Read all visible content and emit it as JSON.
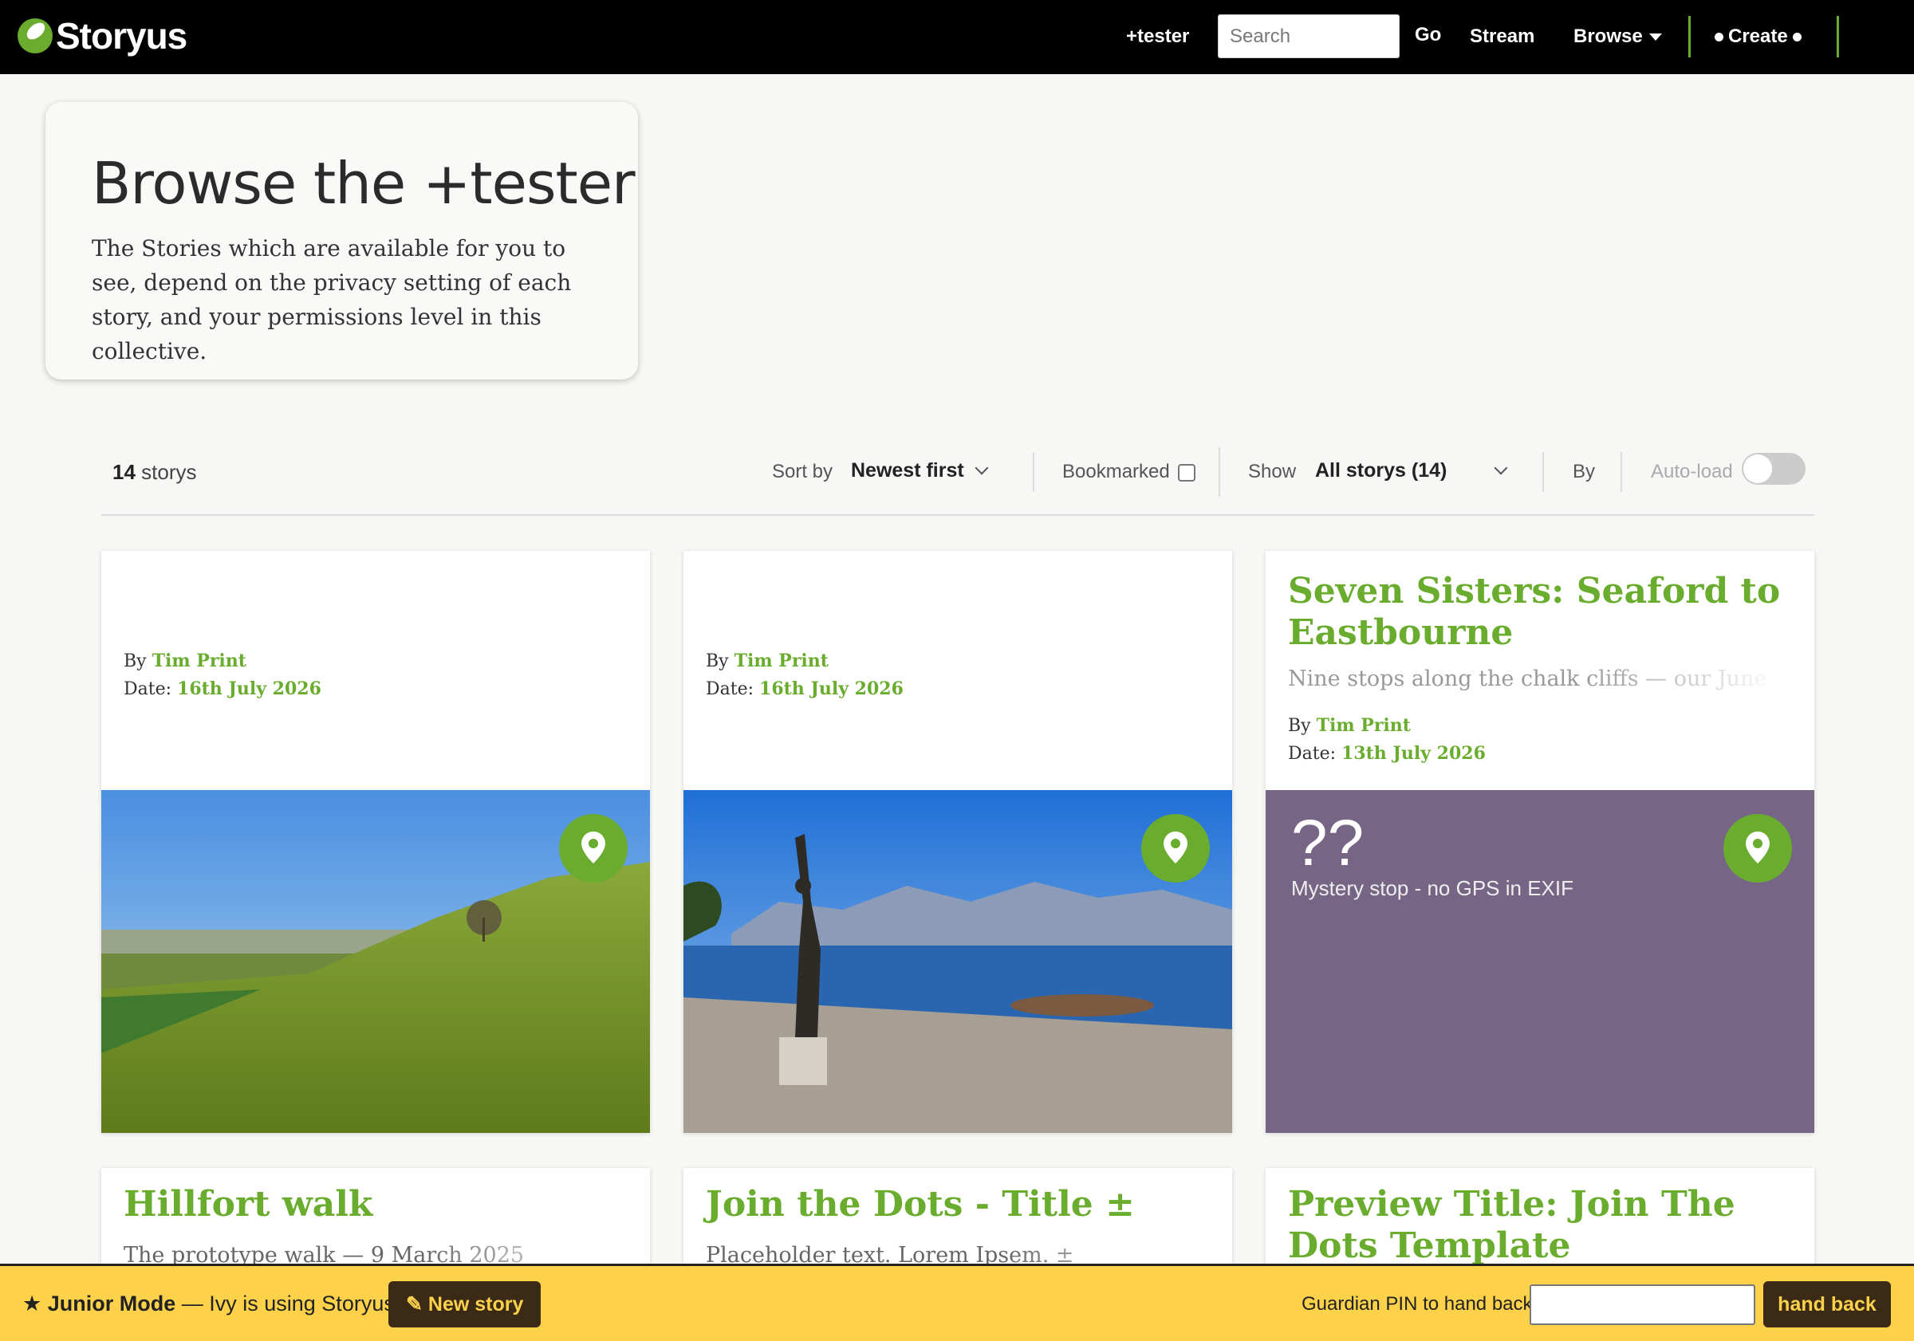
{
  "nav": {
    "brand": "Storyus",
    "collective": "+tester",
    "search_placeholder": "Search",
    "go": "Go",
    "stream": "Stream",
    "browse": "Browse",
    "create": "Create"
  },
  "intro": {
    "title": "Browse the +tester",
    "description": "The Stories which are available for you to see, depend on the privacy setting of each story, and your permissions level in this collective."
  },
  "filters": {
    "count_number": "14",
    "count_label": "storys",
    "sort_label": "Sort by",
    "sort_value": "Newest first",
    "bookmarked_label": "Bookmarked",
    "show_label": "Show",
    "show_value": "All storys (14)",
    "by_label": "By",
    "autoload_label": "Auto-load"
  },
  "cards": [
    {
      "title": "",
      "by_label": "By",
      "author": "Tim Print",
      "date_label": "Date:",
      "date": "16th July 2026",
      "image": "photo-hillside-field",
      "pin_icon": "map-pin-icon"
    },
    {
      "title": "",
      "by_label": "By",
      "author": "Tim Print",
      "date_label": "Date:",
      "date": "16th July 2026",
      "image": "photo-statue-lakeside",
      "pin_icon": "map-pin-icon"
    },
    {
      "title": "Seven Sisters: Seaford to Eastbourne",
      "excerpt": "Nine stops along the chalk cliffs — our June",
      "by_label": "By",
      "author": "Tim Print",
      "date_label": "Date:",
      "date": "13th July 2026",
      "mystery_mark": "??",
      "mystery_text": "Mystery stop - no GPS in EXIF",
      "pin_icon": "map-pin-icon"
    }
  ],
  "cards_row2": [
    {
      "title": "Hillfort walk",
      "excerpt": "The prototype walk — 9 March 2025"
    },
    {
      "title": "Join the Dots - Title ±",
      "excerpt": "Placeholder text. Lorem Ipsem. ±"
    },
    {
      "title": "Preview Title: Join The Dots Template",
      "excerpt": ""
    }
  ],
  "junior": {
    "mode": "Junior Mode",
    "subtitle": "— Ivy is using Storyus",
    "new_story": "✎ New story",
    "pin_label": "Guardian PIN to hand back:",
    "hand_back": "hand back"
  },
  "colors": {
    "accent_green": "#6aac2e",
    "nav_bg": "#000000",
    "junior_bar": "#fdd24a",
    "mystery_bg": "#766584"
  }
}
